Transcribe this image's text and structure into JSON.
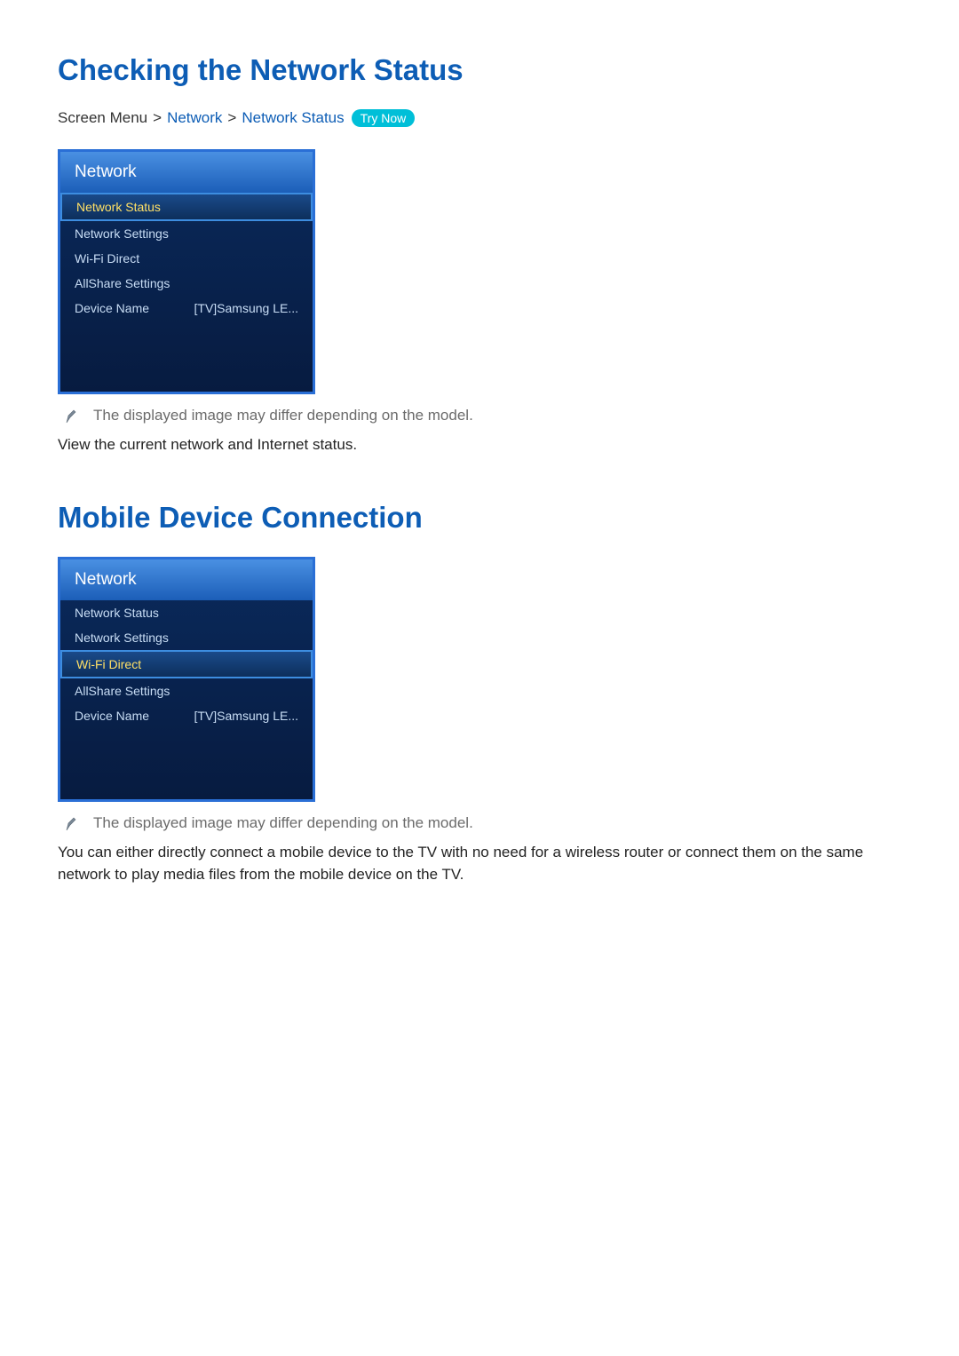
{
  "section1": {
    "title": "Checking the Network Status",
    "breadcrumb": {
      "root": "Screen Menu",
      "sep": ">",
      "l1": "Network",
      "l2": "Network Status",
      "tryNow": "Try Now"
    },
    "panel": {
      "header": "Network",
      "items": [
        {
          "label": "Network Status",
          "value": "",
          "selected": true
        },
        {
          "label": "Network Settings",
          "value": "",
          "selected": false
        },
        {
          "label": "Wi-Fi Direct",
          "value": "",
          "selected": false
        },
        {
          "label": "AllShare Settings",
          "value": "",
          "selected": false
        },
        {
          "label": "Device Name",
          "value": "[TV]Samsung LE...",
          "selected": false
        }
      ]
    },
    "note": "The displayed image may differ depending on the model.",
    "body": "View the current network and Internet status."
  },
  "section2": {
    "title": "Mobile Device Connection",
    "panel": {
      "header": "Network",
      "items": [
        {
          "label": "Network Status",
          "value": "",
          "selected": false
        },
        {
          "label": "Network Settings",
          "value": "",
          "selected": false
        },
        {
          "label": "Wi-Fi Direct",
          "value": "",
          "selected": true
        },
        {
          "label": "AllShare Settings",
          "value": "",
          "selected": false
        },
        {
          "label": "Device Name",
          "value": "[TV]Samsung LE...",
          "selected": false
        }
      ]
    },
    "note": "The displayed image may differ depending on the model.",
    "body": "You can either directly connect a mobile device to the TV with no need for a wireless router or connect them on the same network to play media files from the mobile device on the TV."
  }
}
